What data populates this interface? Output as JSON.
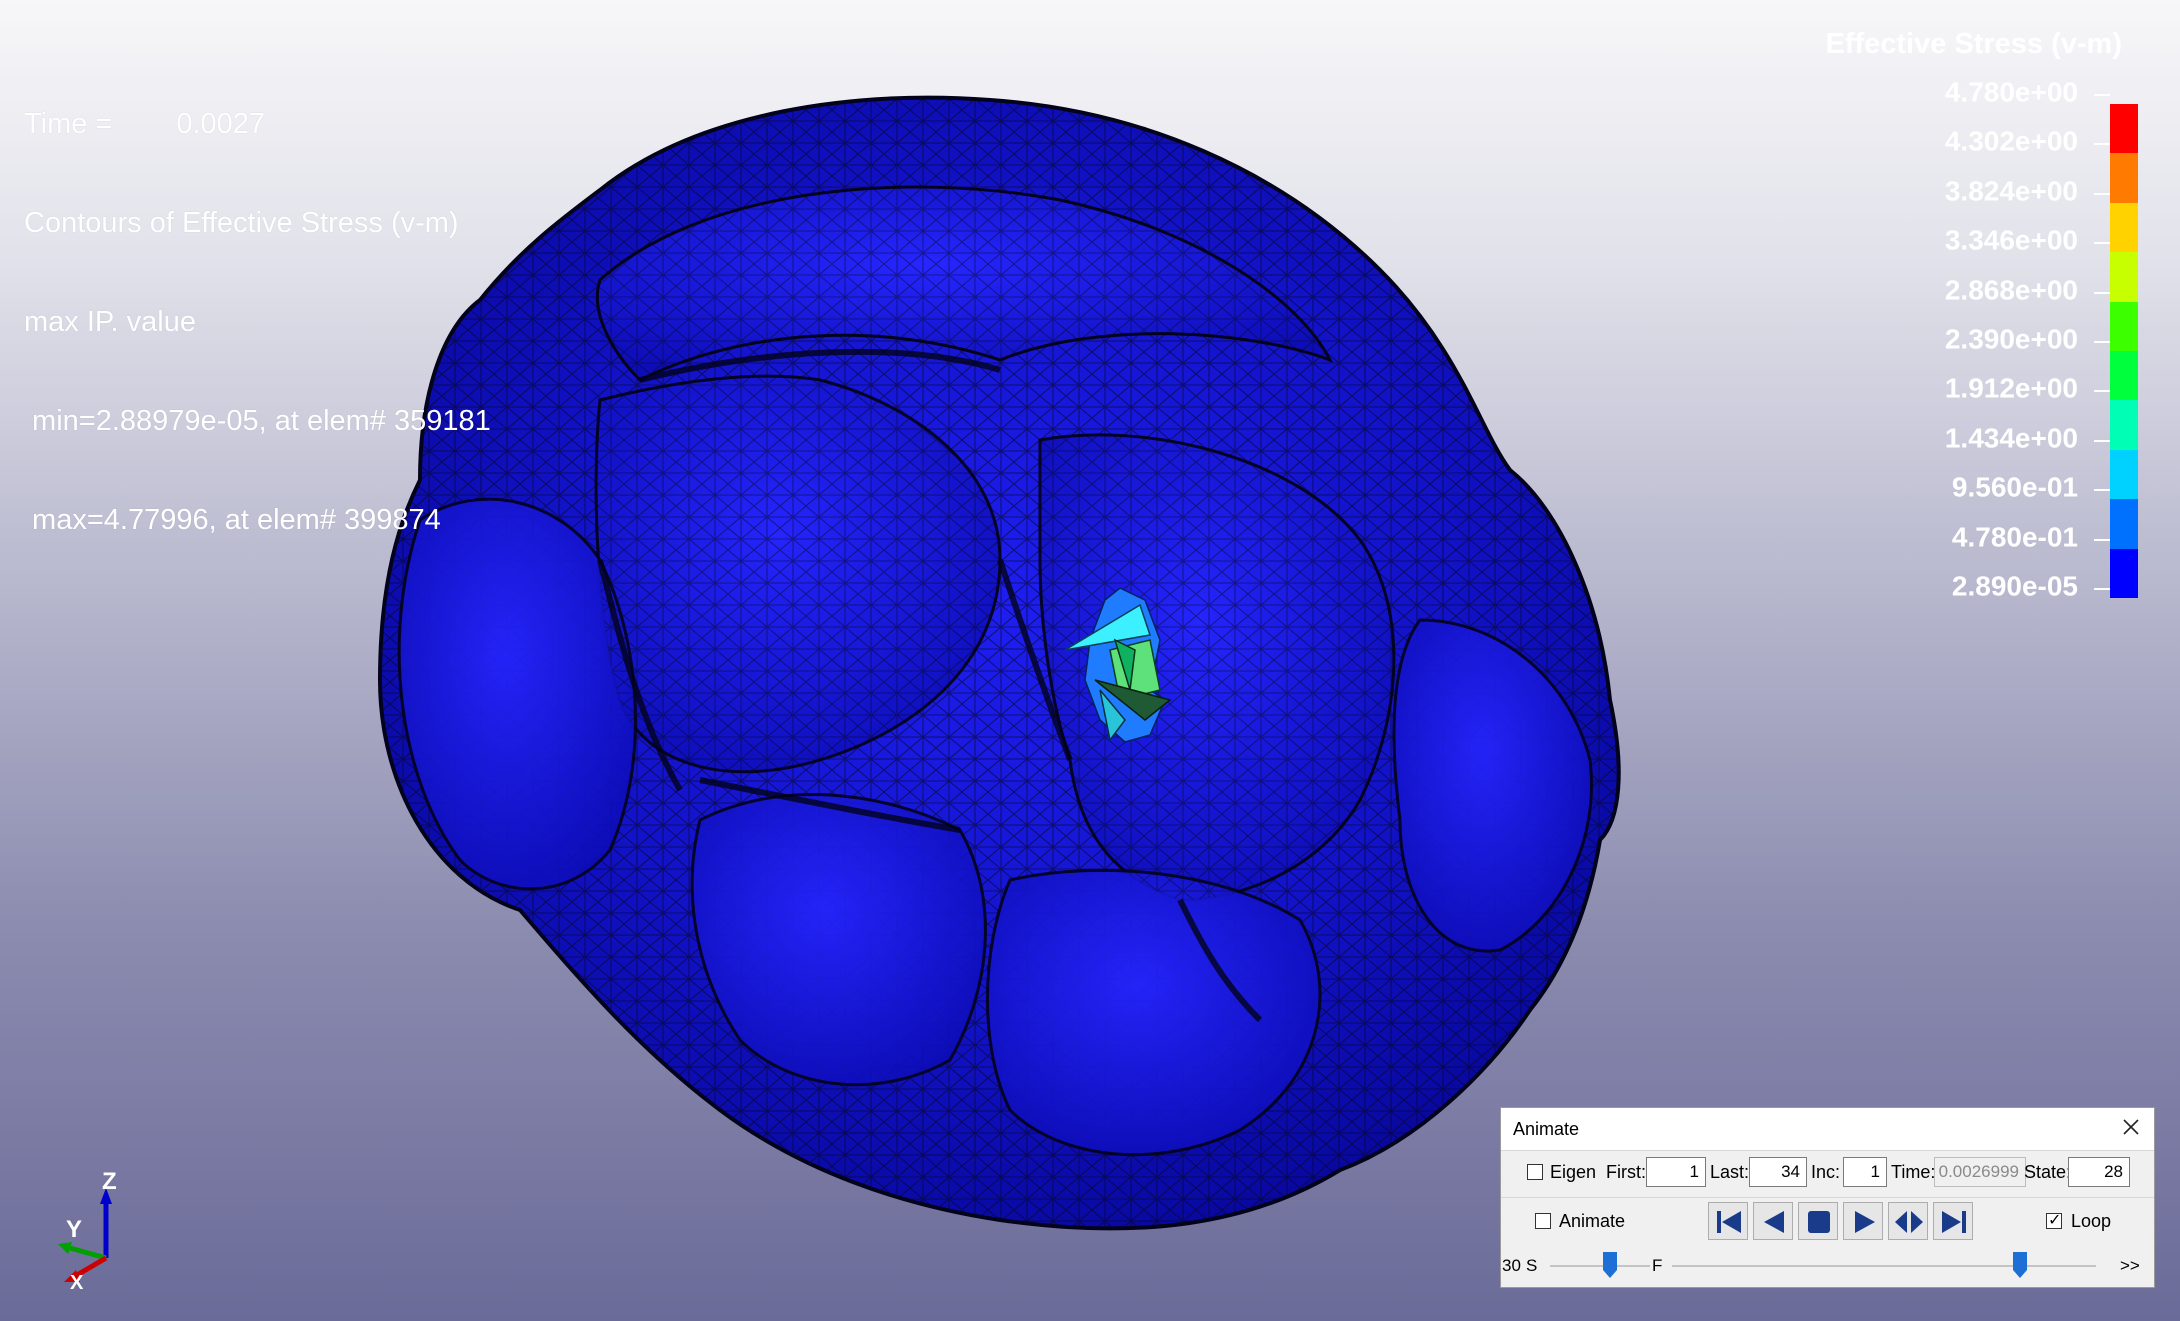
{
  "overlay": {
    "time_label": "Time =",
    "time_value": "0.0027",
    "contour_title": "Contours of Effective Stress (v-m)",
    "value_type": "max IP. value",
    "min_line": " min=2.88979e-05, at elem# 359181",
    "max_line": " max=4.77996, at elem# 399874"
  },
  "legend": {
    "title": "Effective Stress (v-m)",
    "labels": [
      "4.780e+00",
      "4.302e+00",
      "3.824e+00",
      "3.346e+00",
      "2.868e+00",
      "2.390e+00",
      "1.912e+00",
      "1.434e+00",
      "9.560e-01",
      "4.780e-01",
      "2.890e-05"
    ],
    "colors": [
      "#ff0000",
      "#ff7a00",
      "#ffd200",
      "#c8ff00",
      "#3cff00",
      "#00ff3c",
      "#00ffb4",
      "#00d2ff",
      "#0070ff",
      "#0000ff"
    ]
  },
  "axes": {
    "z": "Z",
    "y": "Y",
    "x": "X"
  },
  "animate_dialog": {
    "title": "Animate",
    "eigen_label": "Eigen",
    "eigen_checked": false,
    "first_label": "First:",
    "first_value": "1",
    "last_label": "Last:",
    "last_value": "34",
    "inc_label": "Inc:",
    "inc_value": "1",
    "time_label": "Time:",
    "time_value": "0.0026999",
    "state_label": "State:",
    "state_value": "28",
    "animate_label": "Animate",
    "animate_checked": false,
    "loop_label": "Loop",
    "loop_checked": true,
    "speed_label": "30",
    "slow_label": "S",
    "fast_label": "F",
    "more_label": ">>",
    "speed_fraction": 0.6,
    "state_fraction": 0.82,
    "buttons": [
      "first-frame-icon",
      "step-back-icon",
      "stop-icon",
      "play-icon",
      "step-both-icon",
      "last-frame-icon"
    ]
  }
}
